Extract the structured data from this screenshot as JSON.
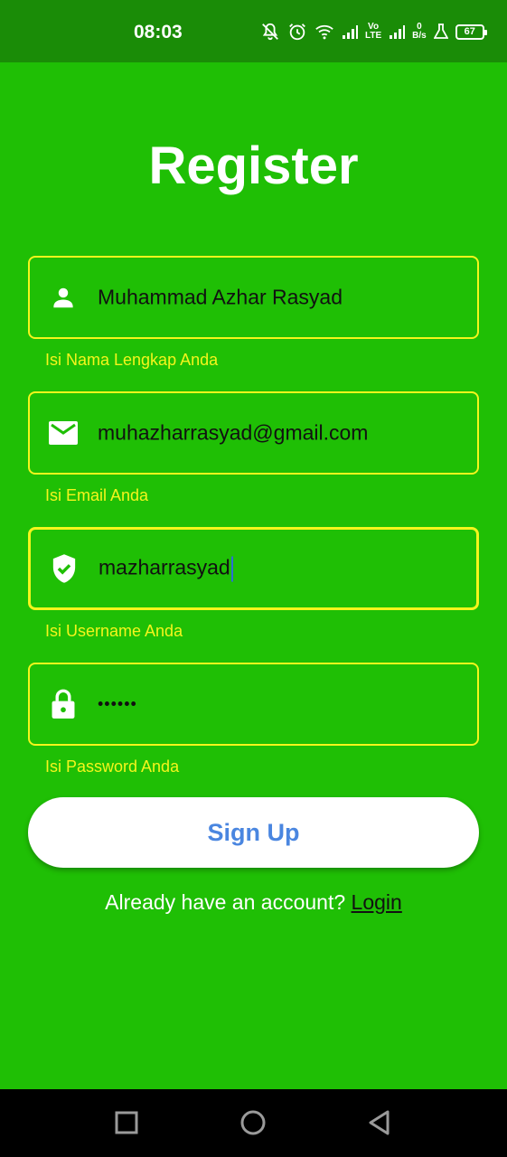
{
  "status_bar": {
    "time": "08:03",
    "volte_label_top": "Vo",
    "volte_label_bottom": "LTE",
    "net_speed_value": "0",
    "net_speed_unit": "B/s",
    "battery_level": "67",
    "icons": [
      "mute-bell-icon",
      "alarm-icon",
      "wifi-icon",
      "signal-icon",
      "volte-icon",
      "signal-icon",
      "net-speed-text",
      "lab-flask-icon",
      "battery-icon"
    ]
  },
  "page": {
    "title": "Register"
  },
  "form": {
    "fields": [
      {
        "icon": "person-icon",
        "value": "Muhammad Azhar Rasyad",
        "hint": "Isi Nama Lengkap Anda"
      },
      {
        "icon": "mail-icon",
        "value": "muhazharrasyad@gmail.com",
        "hint": "Isi Email Anda"
      },
      {
        "icon": "shield-check-icon",
        "value": "mazharrasyad",
        "hint": "Isi Username Anda",
        "focused": true
      },
      {
        "icon": "lock-icon",
        "value": "••••••",
        "hint": "Isi Password Anda"
      }
    ],
    "signup_label": "Sign Up",
    "login_prompt": "Already have an account?",
    "login_link": "Login"
  },
  "nav_bar": {
    "icons": [
      "recent-apps-icon",
      "home-icon",
      "back-icon"
    ]
  },
  "colors": {
    "background": "#1fbf05",
    "status_bar": "#1a8c07",
    "field_border": "#f4f51c",
    "hint_text": "#f4f51c",
    "button_text": "#4a86e0",
    "nav_bar": "#000000"
  }
}
